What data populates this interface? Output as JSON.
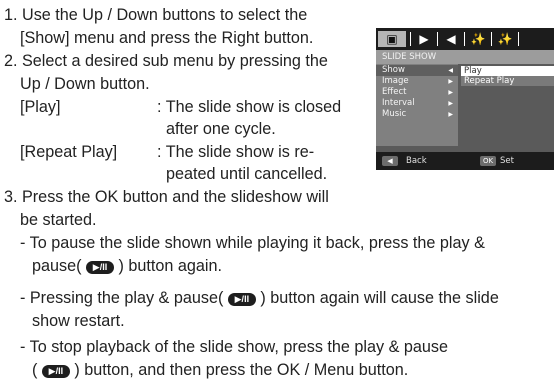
{
  "instructions": {
    "step1_line1": "1. Use the Up / Down buttons to select the",
    "step1_line2": "[Show] menu and press the Right button.",
    "step2_line1": "2. Select a desired sub menu by pressing the",
    "step2_line2": "Up / Down button.",
    "play_term": "[Play]",
    "play_desc_1": ": The slide show is closed",
    "play_desc_2": "after one cycle.",
    "repeat_term": "[Repeat Play]",
    "repeat_desc_1": ": The slide show is re-",
    "repeat_desc_2": "peated until cancelled.",
    "step3_line1": "3. Press the OK button and the slideshow will",
    "step3_line2": "be started.",
    "tip1_a": "- To pause the slide shown while playing it back, press the play &",
    "tip1_b_pre": "pause(",
    "tip1_b_post": ") button again.",
    "tip2_a_pre": "- Pressing the play & pause(",
    "tip2_a_post": ") button again will cause the slide",
    "tip2_b": "show restart.",
    "tip3_a": "- To stop playback of the slide show, press the play & pause",
    "tip3_b_pre": "(",
    "tip3_b_post": ") button, and then press the OK / Menu  button.",
    "play_pause_key": "▶/II"
  },
  "camera_menu": {
    "tab_icons": [
      "▣",
      "▶",
      "◀",
      "✨",
      "✨"
    ],
    "title": "SLIDE SHOW",
    "items": [
      "Show",
      "Image",
      "Effect",
      "Interval",
      "Music"
    ],
    "selected_item": "Show",
    "options": [
      "Play",
      "Repeat Play"
    ],
    "selected_option": "Play",
    "back_key": "◀",
    "back_label": "Back",
    "ok_key": "OK",
    "set_label": "Set"
  }
}
